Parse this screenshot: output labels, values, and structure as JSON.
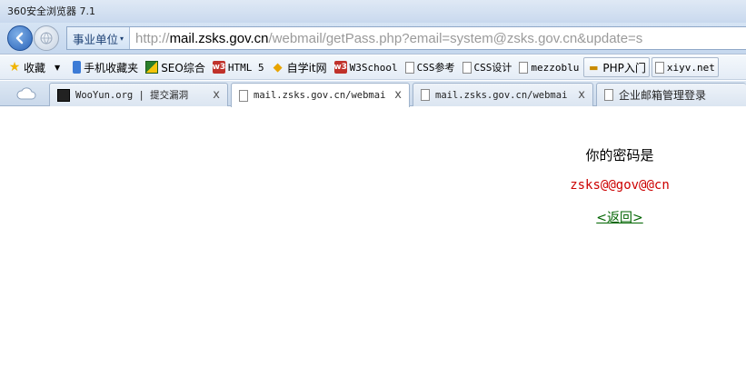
{
  "window": {
    "title": "360安全浏览器 7.1"
  },
  "navbar": {
    "back_icon": "back-arrow-icon",
    "forward_icon": "globe-icon",
    "site_tag": "事业单位",
    "url_prefix": "http://",
    "url_domain": "mail.zsks.gov.cn",
    "url_rest": "/webmail/getPass.php?email=system@zsks.gov.cn&update=s"
  },
  "bookmarks": [
    {
      "label": "收藏",
      "icon": "star-icon"
    },
    {
      "label": "手机收藏夹",
      "icon": "phone-icon"
    },
    {
      "label": "SEO综合",
      "icon": "seo-icon"
    },
    {
      "label": "HTML 5",
      "icon": "w3-icon"
    },
    {
      "label": "自学it网",
      "icon": "graduation-cap-icon"
    },
    {
      "label": "W3School",
      "icon": "w3-icon"
    },
    {
      "label": "CSS参考",
      "icon": "page-icon"
    },
    {
      "label": "CSS设计",
      "icon": "page-icon"
    },
    {
      "label": "mezzoblu",
      "icon": "page-icon"
    },
    {
      "label": "PHP入门",
      "icon": "php-icon"
    },
    {
      "label": "xiyv.net",
      "icon": "page-icon"
    }
  ],
  "tabs": [
    {
      "label": "WooYun.org | 提交漏洞",
      "active": false
    },
    {
      "label": "mail.zsks.gov.cn/webmai",
      "active": true
    },
    {
      "label": "mail.zsks.gov.cn/webmai",
      "active": false
    },
    {
      "label": "企业邮箱管理登录",
      "active": false
    }
  ],
  "tab_close_symbol": "x",
  "content": {
    "heading": "你的密码是",
    "password": "zsks@@gov@@cn",
    "back_link": "<返回>"
  },
  "colors": {
    "password": "#cc0000",
    "back_link": "#006400"
  }
}
